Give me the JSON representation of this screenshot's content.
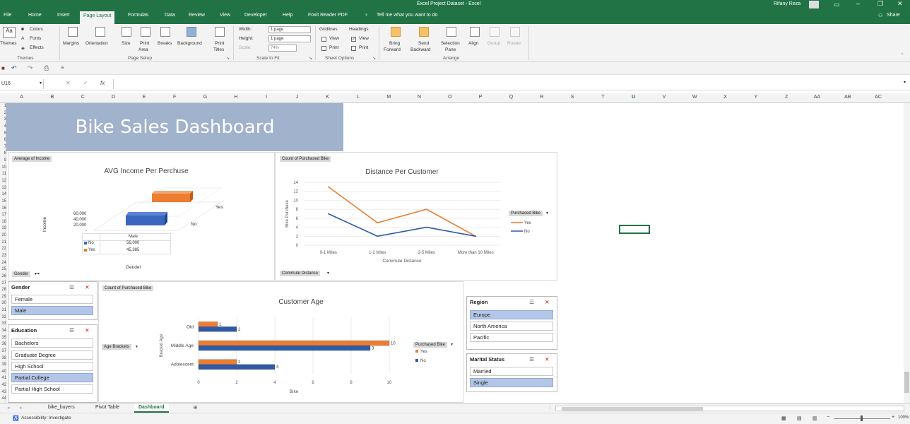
{
  "window": {
    "title": "Excel Project Dataset - Excel",
    "user": "Rifany Reza",
    "share": "Share",
    "tell_me": "Tell me what you want to do"
  },
  "tabs": [
    "File",
    "Home",
    "Insert",
    "Page Layout",
    "Formulas",
    "Data",
    "Review",
    "View",
    "Developer",
    "Help",
    "Foxit Reader PDF"
  ],
  "ribbon": {
    "themes": {
      "themes": "Themes",
      "colors": "Colors",
      "fonts": "Fonts",
      "effects": "Effects",
      "group": "Themes"
    },
    "page_setup": {
      "margins": "Margins",
      "orientation": "Orientation",
      "size": "Size",
      "print_area_1": "Print",
      "print_area_2": "Area",
      "breaks": "Breaks",
      "background": "Background",
      "print_titles_1": "Print",
      "print_titles_2": "Titles",
      "group": "Page Setup"
    },
    "scale": {
      "width_label": "Width:",
      "width_value": "1 page",
      "height_label": "Height:",
      "height_value": "1 page",
      "scale_label": "Scale:",
      "scale_value": "74%",
      "group": "Scale to Fit"
    },
    "sheet_options": {
      "gridlines": "Gridlines",
      "headings": "Headings",
      "view": "View",
      "print": "Print",
      "group": "Sheet Options"
    },
    "arrange": {
      "bring_1": "Bring",
      "bring_2": "Forward",
      "send_1": "Send",
      "send_2": "Backward",
      "selection_1": "Selection",
      "selection_2": "Pane",
      "align": "Align",
      "group_btn": "Group",
      "rotate": "Rotate",
      "group": "Arrange"
    }
  },
  "namebox": "U16",
  "fx": "fx",
  "columns": [
    "A",
    "B",
    "C",
    "D",
    "E",
    "F",
    "G",
    "H",
    "I",
    "J",
    "K",
    "L",
    "M",
    "N",
    "O",
    "P",
    "Q",
    "R",
    "S",
    "T",
    "U",
    "V",
    "W",
    "X",
    "Y",
    "Z",
    "AA",
    "AB",
    "AC"
  ],
  "rows": [
    "1",
    "2",
    "3",
    "4",
    "5",
    "6",
    "7",
    "8",
    "9",
    "10",
    "11",
    "12",
    "13",
    "14",
    "15",
    "16",
    "17",
    "18",
    "19",
    "20",
    "21",
    "22",
    "23",
    "24",
    "25",
    "26",
    "27",
    "28",
    "29",
    "30",
    "31",
    "32",
    "33",
    "34",
    "35",
    "36",
    "37",
    "38",
    "39",
    "40",
    "41",
    "42",
    "43",
    "44"
  ],
  "dashboard": {
    "title": "Bike Sales Dashboard"
  },
  "income_chart": {
    "field_button": "Average of Income",
    "title": "AVG Income Per Perchuse",
    "ylabel": "Income",
    "xlabel": "Gender",
    "yticks": [
      "60,000",
      "40,000",
      "20,000",
      "-"
    ],
    "category": "Male",
    "series_labels": [
      "Yes",
      "No"
    ],
    "table": [
      {
        "name": "No",
        "value": "56,000"
      },
      {
        "name": "Yes",
        "value": "45,385"
      }
    ],
    "gender_button": "Gender"
  },
  "distance_chart": {
    "field_button": "Count of Purchased Bike",
    "commute_button": "Commute Distance",
    "legend_button": "Purchased Bike"
  },
  "age_chart": {
    "field_button": "Count of Purchased Bike",
    "age_button": "Age Brackets",
    "legend_button": "Purchased Bike"
  },
  "chart_data": [
    {
      "type": "line",
      "title": "Distance Per Customer",
      "xlabel": "Commute Distance",
      "ylabel": "Bike Purchase",
      "categories": [
        "0-1 Miles",
        "1-2 Miles",
        "2-5 Miles",
        "More than 10 Miles"
      ],
      "series": [
        {
          "name": "Yes",
          "values": [
            13,
            5,
            8,
            2
          ],
          "color": "#ed7d31"
        },
        {
          "name": "No",
          "values": [
            7,
            2,
            4,
            2
          ],
          "color": "#2e5aa7"
        }
      ],
      "ylim": [
        0,
        14
      ],
      "yticks": [
        0,
        2,
        4,
        6,
        8,
        10,
        12,
        14
      ],
      "legend": "right"
    },
    {
      "type": "bar",
      "orientation": "horizontal",
      "title": "Customer Age",
      "xlabel": "Bike",
      "ylabel": "Bracket Age",
      "categories": [
        "Old",
        "Middle Age",
        "Adolescent"
      ],
      "series": [
        {
          "name": "Yes",
          "values": [
            1,
            10,
            2
          ],
          "color": "#ed7d31"
        },
        {
          "name": "No",
          "values": [
            2,
            9,
            4
          ],
          "color": "#2e5aa7"
        }
      ],
      "xlim": [
        0,
        10
      ],
      "xticks": [
        0,
        2,
        4,
        6,
        8,
        10
      ],
      "legend": "right"
    },
    {
      "type": "bar",
      "orientation": "3d-horizontal",
      "title": "AVG Income Per Perchuse",
      "xlabel": "Gender",
      "ylabel": "Income",
      "categories": [
        "Male"
      ],
      "series": [
        {
          "name": "No",
          "values": [
            56000
          ],
          "color": "#2e5aa7"
        },
        {
          "name": "Yes",
          "values": [
            45385
          ],
          "color": "#ed7d31"
        }
      ]
    }
  ],
  "slicers": {
    "gender": {
      "title": "Gender",
      "items": [
        {
          "label": "Female",
          "on": false
        },
        {
          "label": "Male",
          "on": true
        }
      ]
    },
    "education": {
      "title": "Education",
      "items": [
        {
          "label": "Bachelors",
          "on": false
        },
        {
          "label": "Graduate Degree",
          "on": false
        },
        {
          "label": "High School",
          "on": false
        },
        {
          "label": "Partial College",
          "on": true
        },
        {
          "label": "Partial High School",
          "on": false
        }
      ]
    },
    "region": {
      "title": "Region",
      "items": [
        {
          "label": "Europe",
          "on": true
        },
        {
          "label": "North America",
          "on": false
        },
        {
          "label": "Pacific",
          "on": false
        }
      ]
    },
    "marital": {
      "title": "Marital Status",
      "items": [
        {
          "label": "Married",
          "on": false
        },
        {
          "label": "Single",
          "on": true
        }
      ]
    }
  },
  "sheet_tabs": [
    "bike_buyers",
    "Pivot Table",
    "Dashboard"
  ],
  "status": {
    "accessibility": "Accessibility: Investigate",
    "zoom": "100%"
  }
}
